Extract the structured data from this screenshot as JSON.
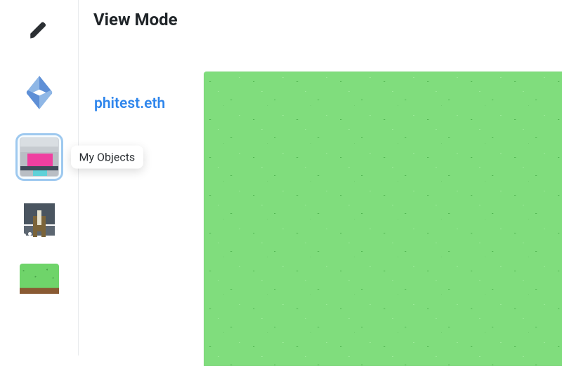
{
  "header": {
    "title": "View Mode"
  },
  "land": {
    "name": "phitest.eth"
  },
  "sidebar": {
    "items": [
      {
        "icon": "pencil-icon"
      },
      {
        "icon": "ens-icon"
      },
      {
        "icon": "object-unicorn",
        "selected": true,
        "tooltip": "My Objects"
      },
      {
        "icon": "object-grave"
      },
      {
        "icon": "object-grass"
      }
    ]
  },
  "colors": {
    "accent": "#2f86ec",
    "selection": "#9ec9ef",
    "grass": "#80dd7d"
  }
}
